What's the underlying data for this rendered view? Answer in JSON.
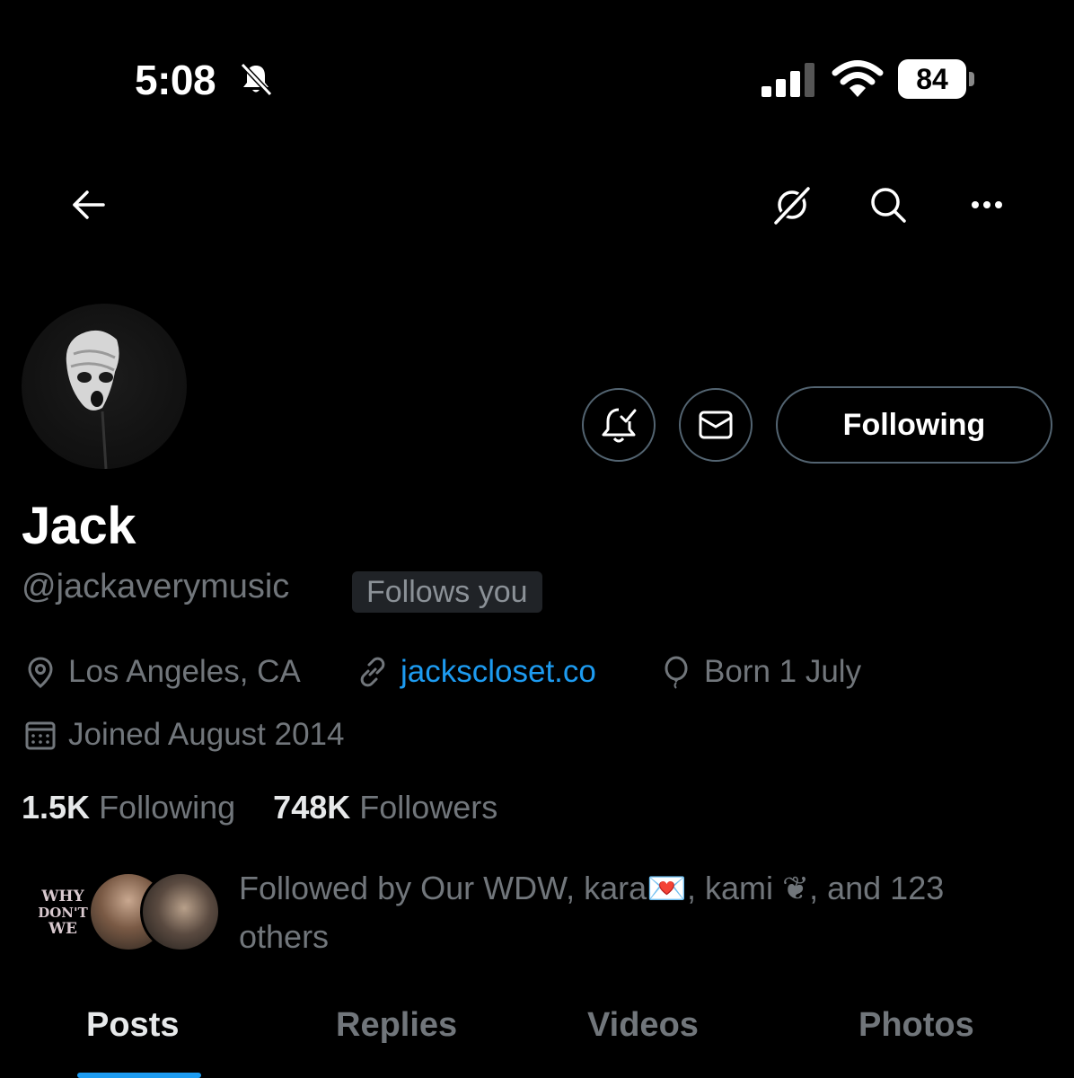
{
  "status_bar": {
    "time": "5:08",
    "battery": "84"
  },
  "nav": {
    "back_icon": "arrow-left-icon",
    "grok_icon": "grok-icon",
    "search_icon": "search-icon",
    "more_icon": "more-icon"
  },
  "profile": {
    "name": "Jack",
    "handle": "@jackaverymusic",
    "follows_you": "Follows you",
    "location": "Los Angeles, CA",
    "website": "jackscloset.co",
    "birthday": "Born 1 July",
    "joined": "Joined August 2014",
    "following_count": "1.5K",
    "following_label": "Following",
    "followers_count": "748K",
    "followers_label": "Followers",
    "followed_by": "Followed by Our WDW, kara💌, kami ❦, and 123 others",
    "mini_avatar_text": [
      "WHY",
      "DON'T",
      "WE"
    ]
  },
  "actions": {
    "following_button": "Following"
  },
  "tabs": [
    {
      "label": "Posts",
      "active": true
    },
    {
      "label": "Replies",
      "active": false
    },
    {
      "label": "Videos",
      "active": false
    },
    {
      "label": "Photos",
      "active": false
    }
  ],
  "colors": {
    "accent": "#1d9bf0",
    "muted": "#71767b",
    "background": "#000000"
  }
}
